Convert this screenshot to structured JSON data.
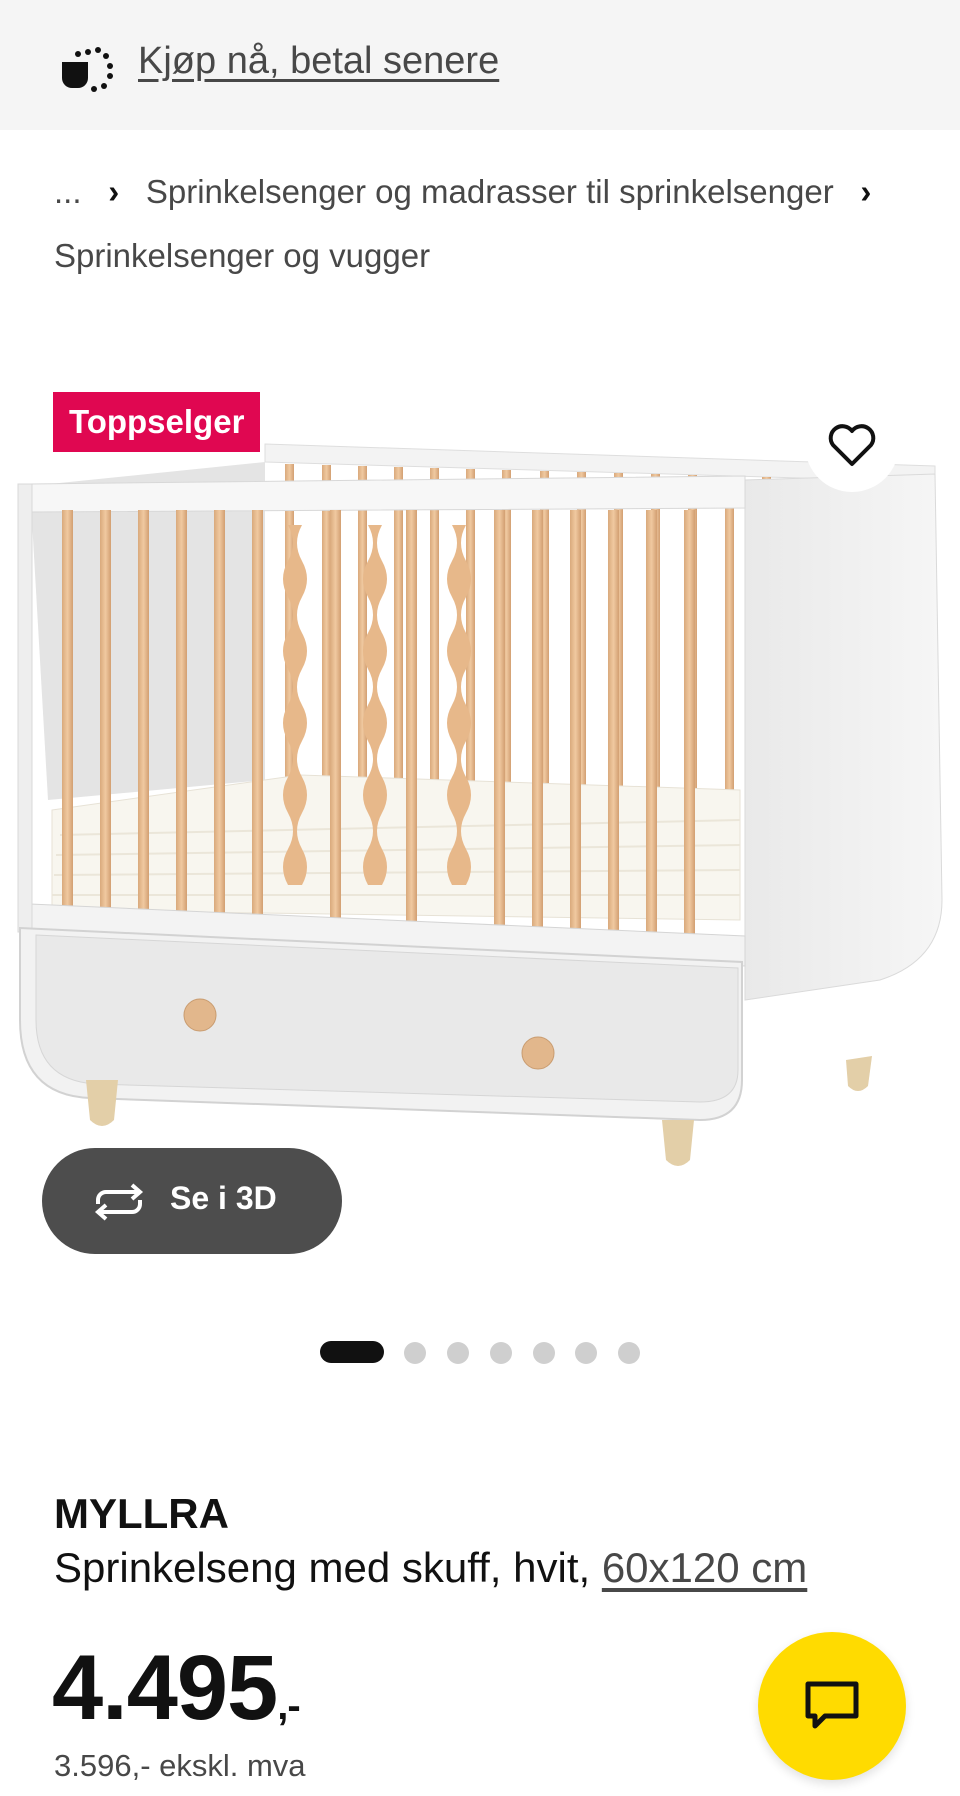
{
  "banner": {
    "icon": "payment-split-icon",
    "link_text": "Kjøp nå, betal senere"
  },
  "breadcrumb": {
    "ellipsis": "...",
    "items": [
      "Sprinkelsenger og madrasser til sprinkelsenger",
      "Sprinkelsenger og vugger"
    ]
  },
  "gallery": {
    "badge": "Toppselger",
    "view3d_label": "Se i 3D",
    "image_count": 7,
    "active_index": 0
  },
  "product": {
    "name": "MYLLRA",
    "description": "Sprinkelseng med skuff, hvit,",
    "size": "60x120 cm",
    "price_main": "4.495",
    "price_suffix": ",-",
    "price_ex_vat": "3.596,- ekskl. mva"
  },
  "colors": {
    "badge": "#e00751",
    "chat": "#ffdb00",
    "view3d": "#4d4d4d"
  }
}
